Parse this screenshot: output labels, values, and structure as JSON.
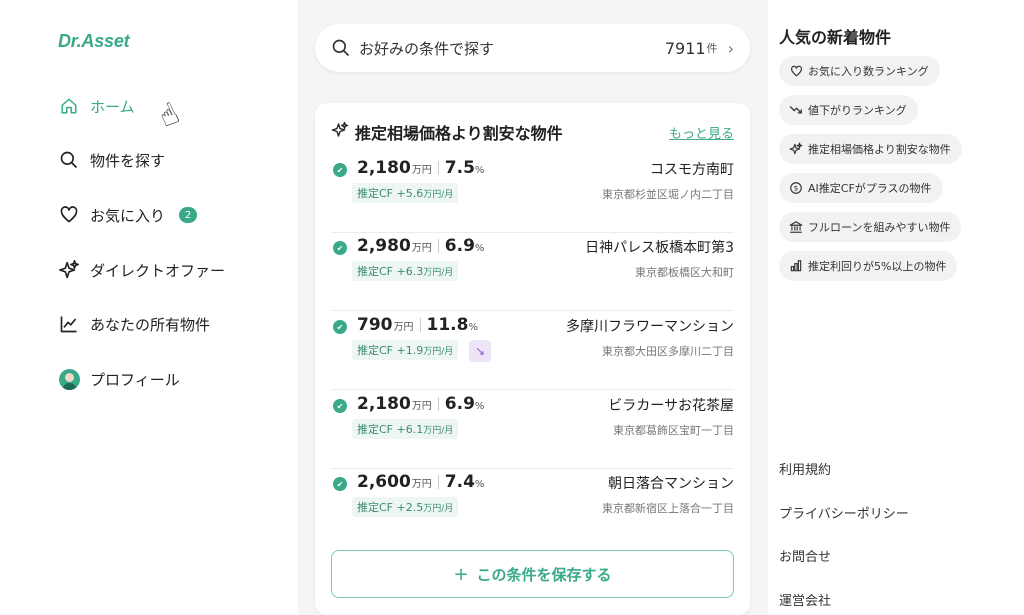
{
  "sidebar": {
    "logo": "Dr.Asset",
    "items": [
      {
        "label": "ホーム",
        "icon": "home-icon"
      },
      {
        "label": "物件を探す",
        "icon": "search-icon"
      },
      {
        "label": "お気に入り",
        "icon": "heart-icon",
        "badge": "2"
      },
      {
        "label": "ダイレクトオファー",
        "icon": "sparkle-icon"
      },
      {
        "label": "あなたの所有物件",
        "icon": "chart-line-icon"
      },
      {
        "label": "プロフィール",
        "icon": "avatar"
      }
    ]
  },
  "search": {
    "placeholder": "お好みの条件で探す",
    "count": "7911",
    "count_unit": "件"
  },
  "card": {
    "title": "推定相場価格より割安な物件",
    "more_link": "もっと見る",
    "save_label": "この条件を保存する",
    "listings": [
      {
        "price": "2,180",
        "price_unit": "万円",
        "yield": "7.5",
        "yield_unit": "%",
        "cf": "推定CF +5.6",
        "cf_unit": "万円/月",
        "name": "コスモ方南町",
        "address": "東京都杉並区堀ノ内二丁目"
      },
      {
        "price": "2,980",
        "price_unit": "万円",
        "yield": "6.9",
        "yield_unit": "%",
        "cf": "推定CF +6.3",
        "cf_unit": "万円/月",
        "name": "日神パレス板橋本町第3",
        "address": "東京都板橋区大和町"
      },
      {
        "price": "790",
        "price_unit": "万円",
        "yield": "11.8",
        "yield_unit": "%",
        "cf": "推定CF +1.9",
        "cf_unit": "万円/月",
        "name": "多摩川フラワーマンション",
        "address": "東京都大田区多摩川二丁目",
        "trend_icon": "trending-down-icon"
      },
      {
        "price": "2,180",
        "price_unit": "万円",
        "yield": "6.9",
        "yield_unit": "%",
        "cf": "推定CF +6.1",
        "cf_unit": "万円/月",
        "name": "ビラカーサお花茶屋",
        "address": "東京都葛飾区宝町一丁目"
      },
      {
        "price": "2,600",
        "price_unit": "万円",
        "yield": "7.4",
        "yield_unit": "%",
        "cf": "推定CF +2.5",
        "cf_unit": "万円/月",
        "name": "朝日落合マンション",
        "address": "東京都新宿区上落合一丁目"
      }
    ]
  },
  "right": {
    "title": "人気の新着物件",
    "tags": [
      {
        "label": "お気に入り数ランキング",
        "icon": "heart-icon"
      },
      {
        "label": "値下がりランキング",
        "icon": "trending-down-icon"
      },
      {
        "label": "推定相場価格より割安な物件",
        "icon": "sparkle-icon"
      },
      {
        "label": "AI推定CFがプラスの物件",
        "icon": "dollar-circle-icon"
      },
      {
        "label": "フルローンを組みやすい物件",
        "icon": "bank-icon"
      },
      {
        "label": "推定利回りが5%以上の物件",
        "icon": "bar-chart-icon"
      }
    ],
    "footer_links": [
      "利用規約",
      "プライバシーポリシー",
      "お問合せ",
      "運営会社"
    ]
  },
  "colors": {
    "accent": "#3aa98a",
    "background": "#f4f5f4",
    "trend_chip": "#ede4f8"
  }
}
